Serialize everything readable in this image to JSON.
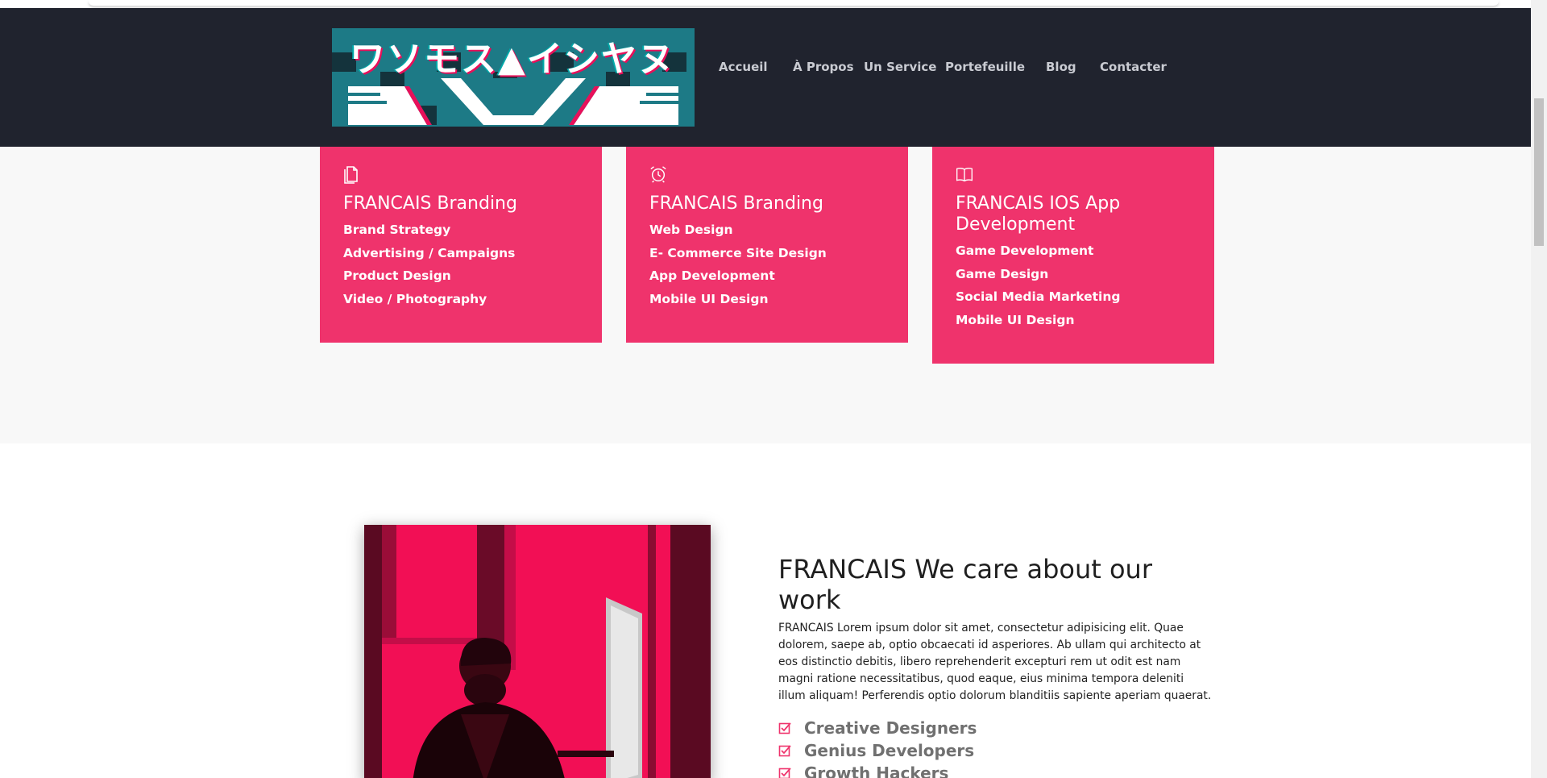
{
  "header": {
    "logo_text": "ワソモス▲イシヤヌ",
    "nav": [
      {
        "label": "Accueil"
      },
      {
        "label": "À Propos"
      },
      {
        "label": "Un Service"
      },
      {
        "label": "Portefeuille"
      },
      {
        "label": "Blog"
      },
      {
        "label": "Contacter"
      }
    ]
  },
  "services": {
    "cards": [
      {
        "icon": "document-icon",
        "title": "FRANCAIS Branding",
        "items": [
          "Brand Strategy",
          "Advertising / Campaigns",
          "Product Design",
          "Video / Photography"
        ]
      },
      {
        "icon": "alarm-clock-icon",
        "title": "FRANCAIS Branding",
        "items": [
          "Web Design",
          "E- Commerce Site Design",
          "App Development",
          "Mobile UI Design"
        ]
      },
      {
        "icon": "open-book-icon",
        "title": "FRANCAIS IOS App Development",
        "items": [
          "Game Development",
          "Game Design",
          "Social Media Marketing",
          "Mobile UI Design"
        ]
      }
    ]
  },
  "about": {
    "title": "FRANCAIS We care about our work",
    "body": "FRANCAIS Lorem ipsum dolor sit amet, consectetur adipisicing elit. Quae dolorem, saepe ab, optio obcaecati id asperiores. Ab ullam qui architecto at eos distinctio debitis, libero reprehenderit excepturi rem ut odit est nam magni ratione necessitatibus, quod eaque, eius minima tempora deleniti illum aliquam! Perferendis optio dolorum blanditiis sapiente aperiam quaerat.",
    "features": [
      "Creative Designers",
      "Genius Developers",
      "Growth Hackers"
    ]
  },
  "colors": {
    "header_bg": "#20232e",
    "accent": "#ef336c",
    "photo_tint": "#f20f55",
    "section_bg": "#f8f8f8"
  }
}
